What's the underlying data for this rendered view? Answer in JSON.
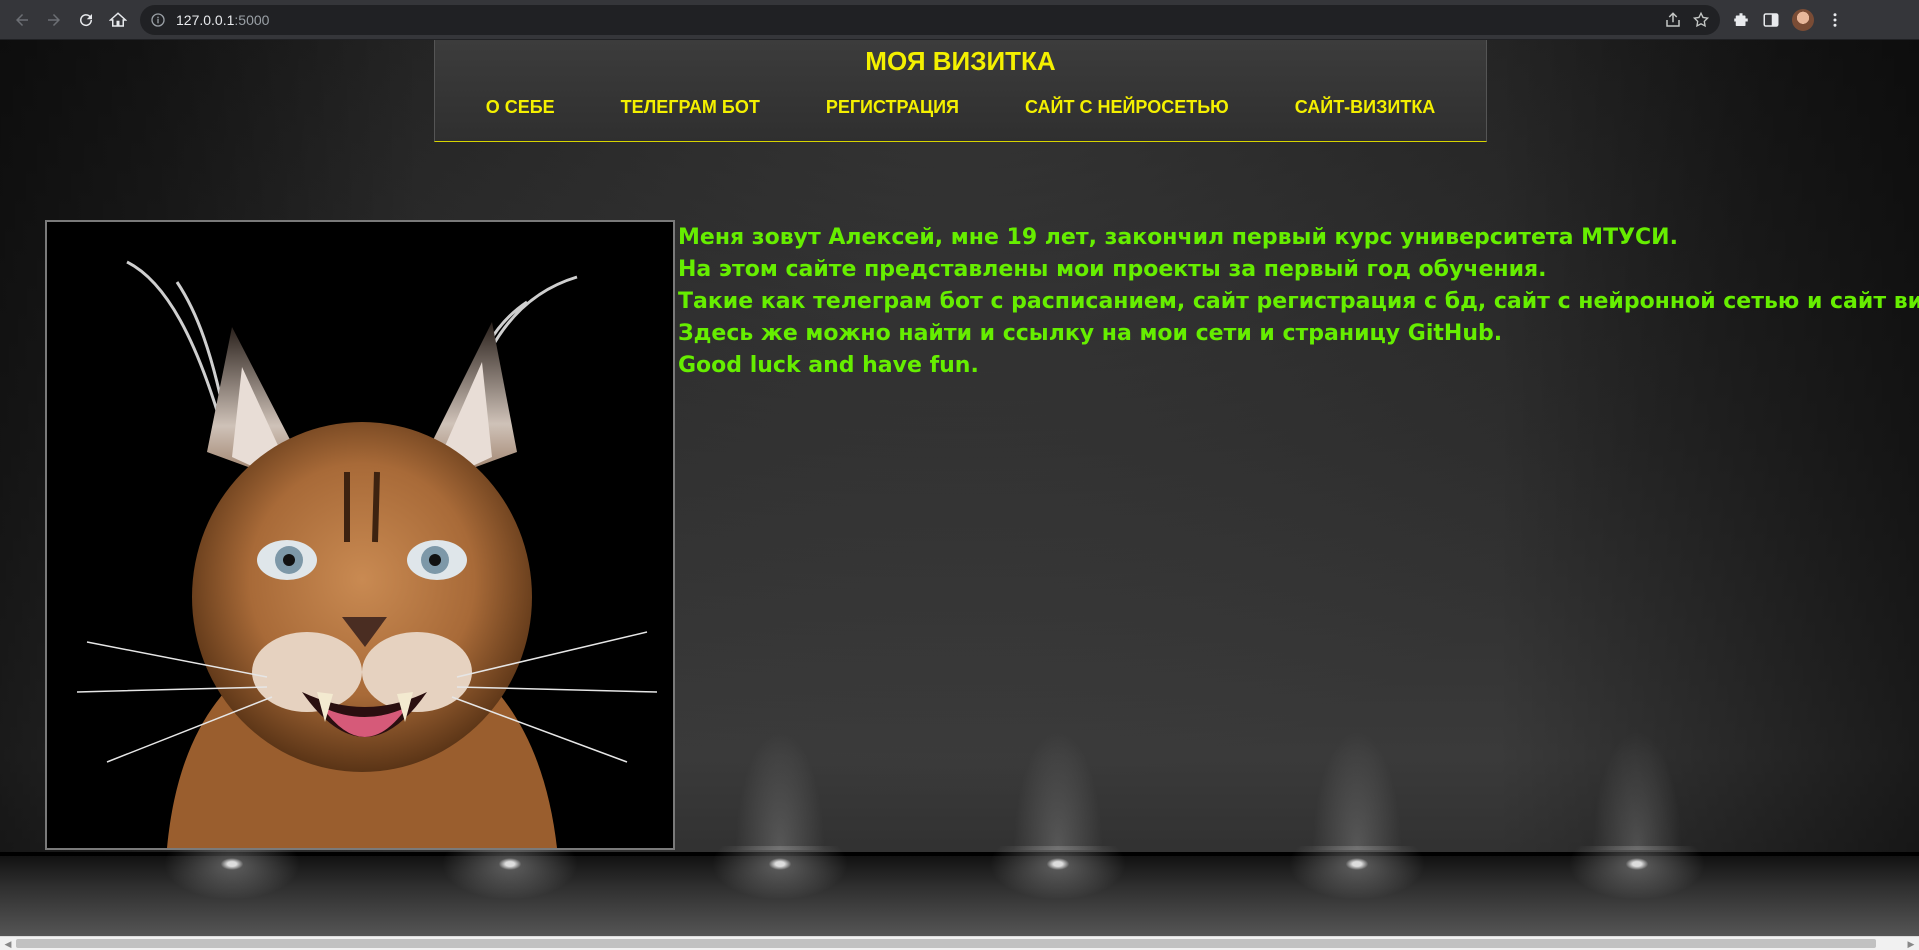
{
  "browser": {
    "url_host": "127.0.0.1",
    "url_port": ":5000"
  },
  "site": {
    "title": "МОЯ ВИЗИТКА",
    "nav": [
      {
        "label": "О СЕБЕ"
      },
      {
        "label": "ТЕЛЕГРАМ БОТ"
      },
      {
        "label": "РЕГИСТРАЦИЯ"
      },
      {
        "label": "САЙТ С НЕЙРОСЕТЬЮ"
      },
      {
        "label": "САЙТ-ВИЗИТКА"
      }
    ]
  },
  "about": {
    "lines": [
      "Меня зовут Алексей, мне 19 лет, закончил первый курс университета МТУСИ.",
      "На этом сайте представлены мои проекты за первый год обучения.",
      "Такие как телеграм бот с расписанием, сайт регистрация с бд, сайт с нейронной сетью и сайт визитка.",
      "Здесь же можно найти и ссылку на мои сети и страницу GitHub.",
      "Good luck and have fun."
    ]
  },
  "colors": {
    "accent_yellow": "#f4f000",
    "text_green": "#66ee00"
  }
}
